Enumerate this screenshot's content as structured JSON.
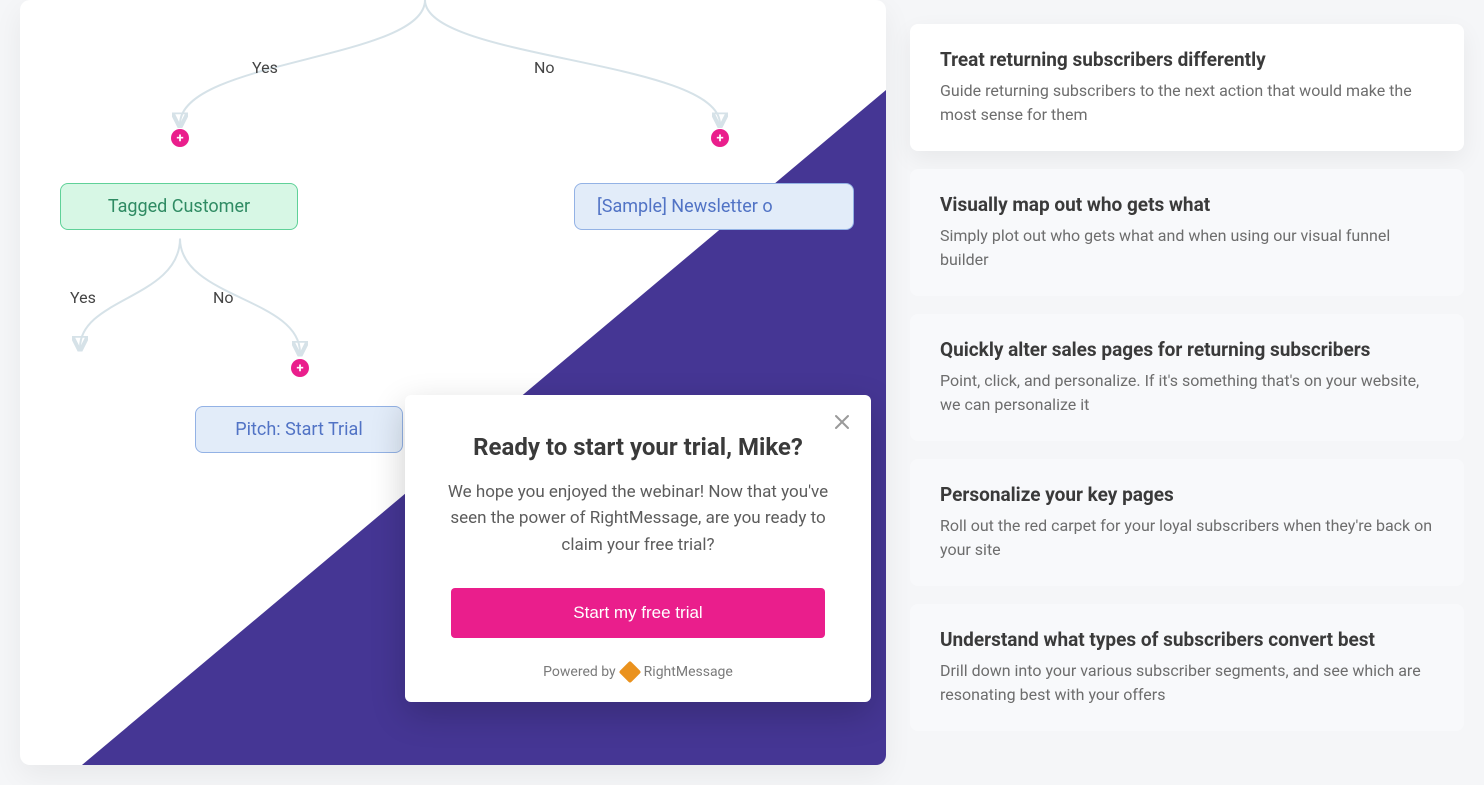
{
  "flow": {
    "yes1_label": "Yes",
    "no1_label": "No",
    "yes2_label": "Yes",
    "no2_label": "No",
    "node_tagged": "Tagged Customer",
    "node_sample": "[Sample] Newsletter o",
    "node_pitch": "Pitch: Start Trial"
  },
  "modal": {
    "heading": "Ready to start your trial, Mike?",
    "body": "We hope you enjoyed the webinar! Now that you've seen the power of RightMessage, are you ready to claim your free trial?",
    "cta_label": "Start my free trial",
    "powered_prefix": "Powered by",
    "powered_brand": "RightMessage"
  },
  "features": [
    {
      "title": "Treat returning subscribers differently",
      "desc": "Guide returning subscribers to the next action that would make the most sense for them"
    },
    {
      "title": "Visually map out who gets what",
      "desc": "Simply plot out who gets what and when using our visual funnel builder"
    },
    {
      "title": "Quickly alter sales pages for returning subscribers",
      "desc": "Point, click, and personalize. If it's something that's on your website, we can personalize it"
    },
    {
      "title": "Personalize your key pages",
      "desc": "Roll out the red carpet for your loyal subscribers when they're back on your site"
    },
    {
      "title": "Understand what types of subscribers convert best",
      "desc": "Drill down into your various subscriber segments, and see which are resonating best with your offers"
    }
  ]
}
